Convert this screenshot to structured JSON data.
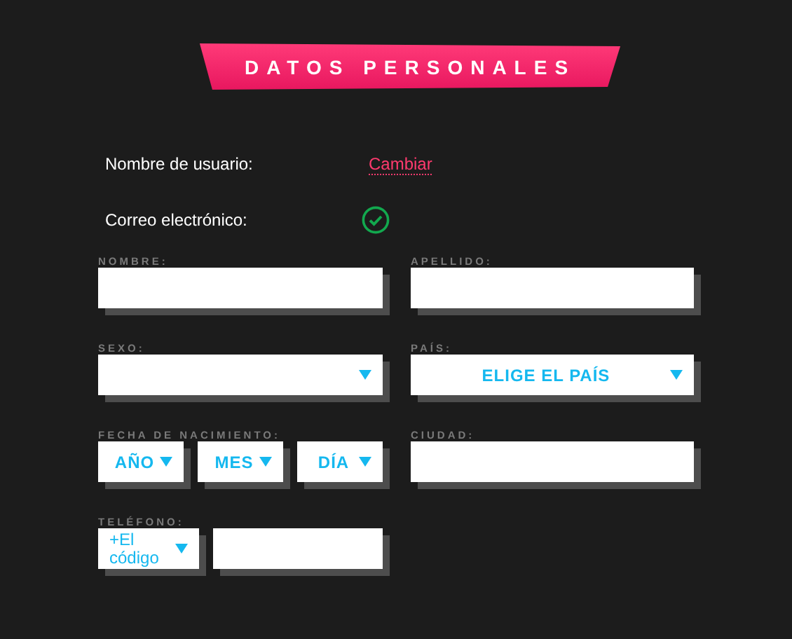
{
  "title": "DATOS PERSONALES",
  "account": {
    "username_label": "Nombre de usuario:",
    "change_link": "Cambiar",
    "email_label": "Correo electrónico:",
    "email_verified": true
  },
  "fields": [
    {
      "kind": "text",
      "label": "NOMBRE:"
    },
    {
      "kind": "text",
      "label": "APELLIDO:"
    },
    {
      "kind": "select",
      "label": "SEXO:"
    },
    {
      "kind": "select",
      "label": "PAÍS:",
      "value": "ELIGE EL PAÍS"
    },
    {
      "kind": "date",
      "label": "FECHA DE NACIMIENTO:",
      "parts": [
        "AÑO",
        "MES",
        "DÍA"
      ]
    },
    {
      "kind": "text",
      "label": "CIUDAD:"
    },
    {
      "kind": "phone",
      "label": "TELÉFONO:",
      "code": "+El código"
    }
  ]
}
